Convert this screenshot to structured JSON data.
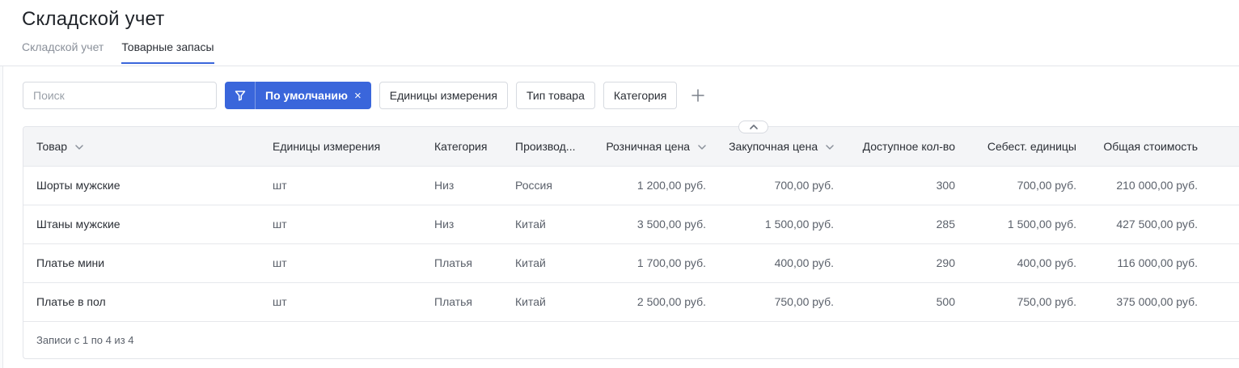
{
  "header": {
    "title": "Складской учет",
    "tabs": [
      {
        "label": "Складской учет",
        "active": false
      },
      {
        "label": "Товарные запасы",
        "active": true
      }
    ]
  },
  "toolbar": {
    "search_placeholder": "Поиск",
    "search_value": "",
    "filter_label": "По умолчанию",
    "filter_close": "×",
    "chips": [
      "Единицы измерения",
      "Тип товара",
      "Категория"
    ],
    "add_icon": "plus-icon"
  },
  "colors": {
    "accent": "#3a66db",
    "header_bg": "#f4f5f7",
    "border": "#e3e5ea"
  },
  "table": {
    "columns": [
      {
        "label": "Товар",
        "sortable": true
      },
      {
        "label": "Единицы измерения",
        "sortable": false
      },
      {
        "label": "Категория",
        "sortable": false
      },
      {
        "label": "Производ...",
        "sortable": false
      },
      {
        "label": "Розничная цена",
        "sortable": true
      },
      {
        "label": "Закупочная цена",
        "sortable": true
      },
      {
        "label": "Доступное кол-во",
        "sortable": false
      },
      {
        "label": "Себест. единицы",
        "sortable": false
      },
      {
        "label": "Общая стоимость",
        "sortable": false
      }
    ],
    "rows": [
      [
        "Шорты мужские",
        "шт",
        "Низ",
        "Россия",
        "1 200,00 руб.",
        "700,00 руб.",
        "300",
        "700,00 руб.",
        "210 000,00 руб."
      ],
      [
        "Штаны мужские",
        "шт",
        "Низ",
        "Китай",
        "3 500,00 руб.",
        "1 500,00 руб.",
        "285",
        "1 500,00 руб.",
        "427 500,00 руб."
      ],
      [
        "Платье мини",
        "шт",
        "Платья",
        "Китай",
        "1 700,00 руб.",
        "400,00 руб.",
        "290",
        "400,00 руб.",
        "116 000,00 руб."
      ],
      [
        "Платье в пол",
        "шт",
        "Платья",
        "Китай",
        "2 500,00 руб.",
        "750,00 руб.",
        "500",
        "750,00 руб.",
        "375 000,00 руб."
      ]
    ],
    "footer": "Записи с 1 по 4 из 4"
  }
}
